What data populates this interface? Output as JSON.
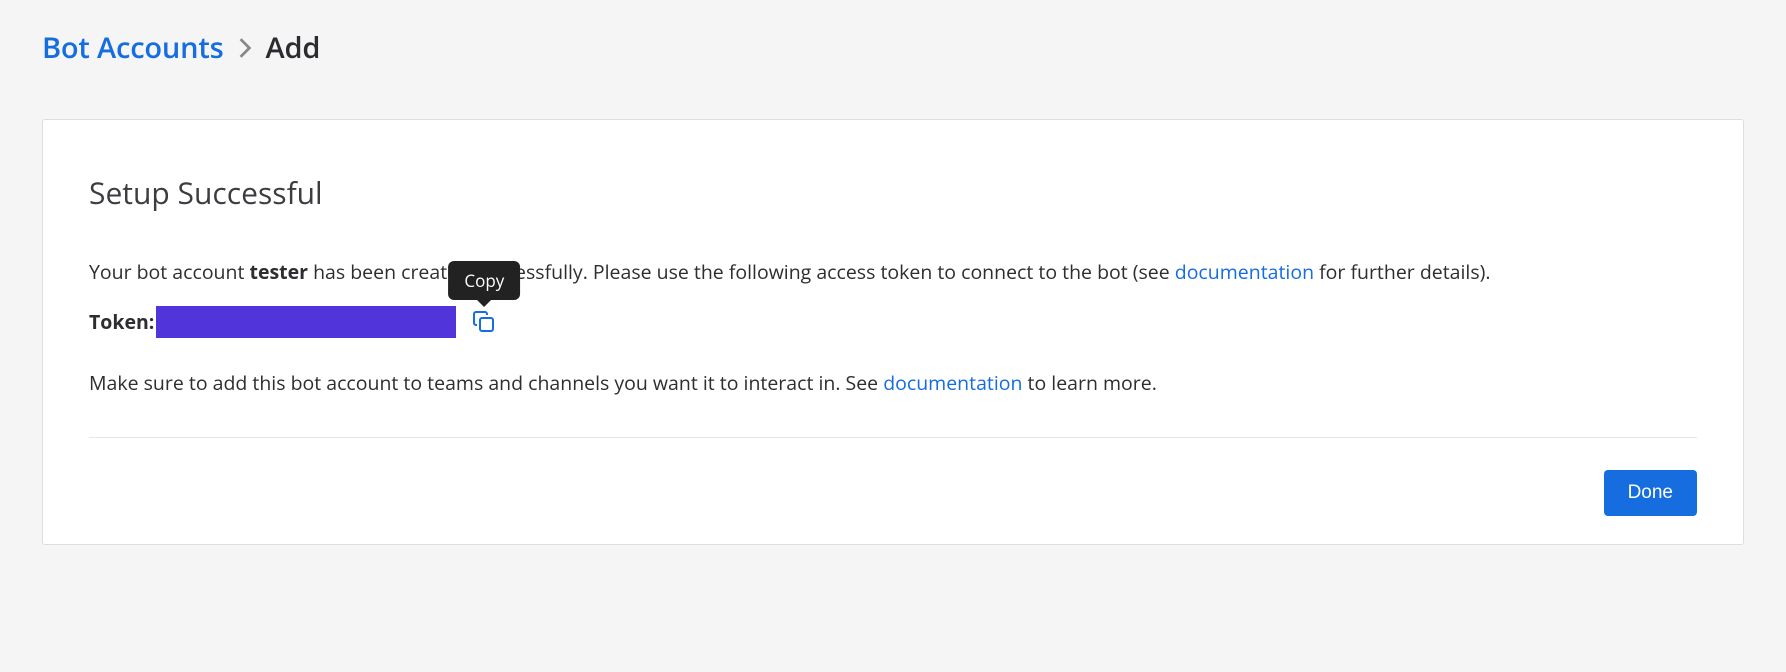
{
  "breadcrumb": {
    "parent": "Bot Accounts",
    "current": "Add"
  },
  "panel": {
    "title": "Setup Successful",
    "msg1_pre": "Your bot account ",
    "msg1_bot_name": "tester",
    "msg1_post": " has been created successfully. Please use the following access token to connect to the bot (see ",
    "msg1_link": "documentation",
    "msg1_tail": " for further details).",
    "token_label": "Token:",
    "copy_tooltip": "Copy",
    "msg2_pre": "Make sure to add this bot account to teams and channels you want it to interact in. See ",
    "msg2_link": "documentation",
    "msg2_tail": " to learn more."
  },
  "footer": {
    "done": "Done"
  },
  "colors": {
    "accent": "#166de0",
    "redaction": "#5234db"
  }
}
